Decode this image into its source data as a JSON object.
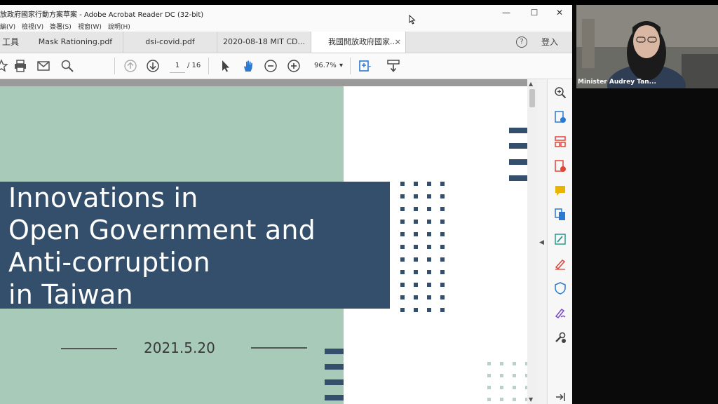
{
  "window": {
    "title": "放政府國家行動方案草案 - Adobe Acrobat Reader DC (32-bit)",
    "minimize": "—",
    "maximize": "☐",
    "close": "✕"
  },
  "menu": [
    "編(V)",
    "檢視(V)",
    "簽署(S)",
    "視窗(W)",
    "說明(H)"
  ],
  "tabs": {
    "tools_label": "工具",
    "items": [
      "Mask Rationing.pdf",
      "dsi-covid.pdf",
      "2020-08-18 MIT CD...",
      "我國開放政府國家..."
    ],
    "close_glyph": "×"
  },
  "account": {
    "help": "?",
    "login": "登入"
  },
  "toolbar": {
    "page_current": "1",
    "page_total": "/ 16",
    "zoom": "96.7%",
    "zoom_caret": "▾"
  },
  "slide": {
    "title_lines": [
      "Innovations in",
      "Open Government and",
      "Anti-corruption",
      "in Taiwan"
    ],
    "date": "2021.5.20"
  },
  "video": {
    "participant": "Minister Audrey Tan..."
  },
  "colors": {
    "green_panel": "#a8cbb9",
    "title_box": "#344f6b",
    "accent_navy": "#344f6b",
    "acrobat_blue": "#2a79d2",
    "acrobat_red": "#e0453a",
    "acrobat_purple": "#7a4cc7"
  },
  "icons": {
    "toolbar": [
      "star-icon",
      "print-icon",
      "mail-icon",
      "zoom-icon",
      "page-up-icon",
      "page-down-icon",
      "select-cursor-icon",
      "hand-icon",
      "zoom-out-icon",
      "zoom-in-icon",
      "fit-page-icon",
      "scroll-mode-icon"
    ],
    "right_panel": [
      "search-zoom-icon",
      "export-pdf-icon",
      "organize-pages-icon",
      "create-pdf-icon",
      "comment-icon",
      "combine-files-icon",
      "edit-pdf-icon",
      "fill-sign-icon",
      "protect-icon",
      "sign-icon",
      "more-tools-icon",
      "expand-panel-icon"
    ]
  }
}
